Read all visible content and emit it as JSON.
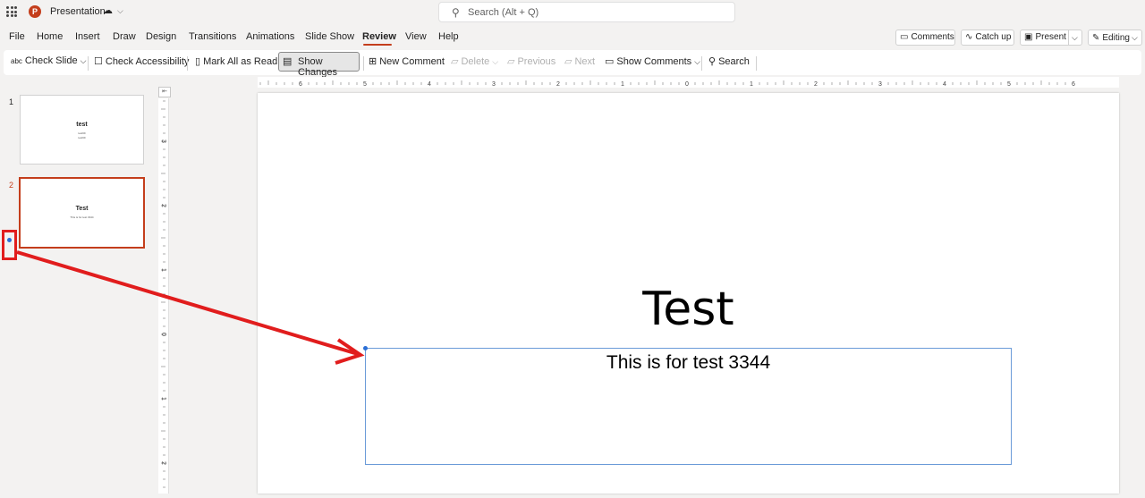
{
  "app": {
    "title": "Presentation",
    "logo_letter": "P",
    "sync_icon": "cloud-sync-icon",
    "chevron": "⌵"
  },
  "search": {
    "placeholder": "Search (Alt + Q)"
  },
  "tabs": [
    {
      "label": "File"
    },
    {
      "label": "Home"
    },
    {
      "label": "Insert"
    },
    {
      "label": "Draw"
    },
    {
      "label": "Design"
    },
    {
      "label": "Transitions"
    },
    {
      "label": "Animations"
    },
    {
      "label": "Slide Show"
    },
    {
      "label": "Review"
    },
    {
      "label": "View"
    },
    {
      "label": "Help"
    }
  ],
  "active_tab": "Review",
  "header_buttons": {
    "comments": "Comments",
    "catch_up": "Catch up",
    "present": "Present",
    "editing": "Editing"
  },
  "ribbon": {
    "check_slide": "Check Slide",
    "check_accessibility": "Check Accessibility",
    "mark_all_read": "Mark All as Read",
    "show_changes": "Show Changes",
    "new_comment": "New Comment",
    "delete": "Delete",
    "previous": "Previous",
    "next": "Next",
    "show_comments": "Show Comments",
    "search": "Search"
  },
  "slides_panel": {
    "slides": [
      {
        "number": "1",
        "title": "test",
        "lines": [
          "test69",
          "test69"
        ]
      },
      {
        "number": "2",
        "title": "Test",
        "lines": [
          "This is for test 3344"
        ]
      }
    ]
  },
  "rulers": {
    "horizontal_labels": [
      "6",
      "5",
      "4",
      "3",
      "2",
      "1",
      "0",
      "1",
      "2",
      "3",
      "4",
      "5",
      "6"
    ],
    "vertical_labels": [
      "3",
      "2",
      "1",
      "0",
      "1",
      "2"
    ]
  },
  "slide": {
    "title": "Test",
    "body_text": "This is for test 3344"
  },
  "colors": {
    "accent": "#c43e1c",
    "annotation": "#e11d1d",
    "selection": "#6b9bd8"
  }
}
